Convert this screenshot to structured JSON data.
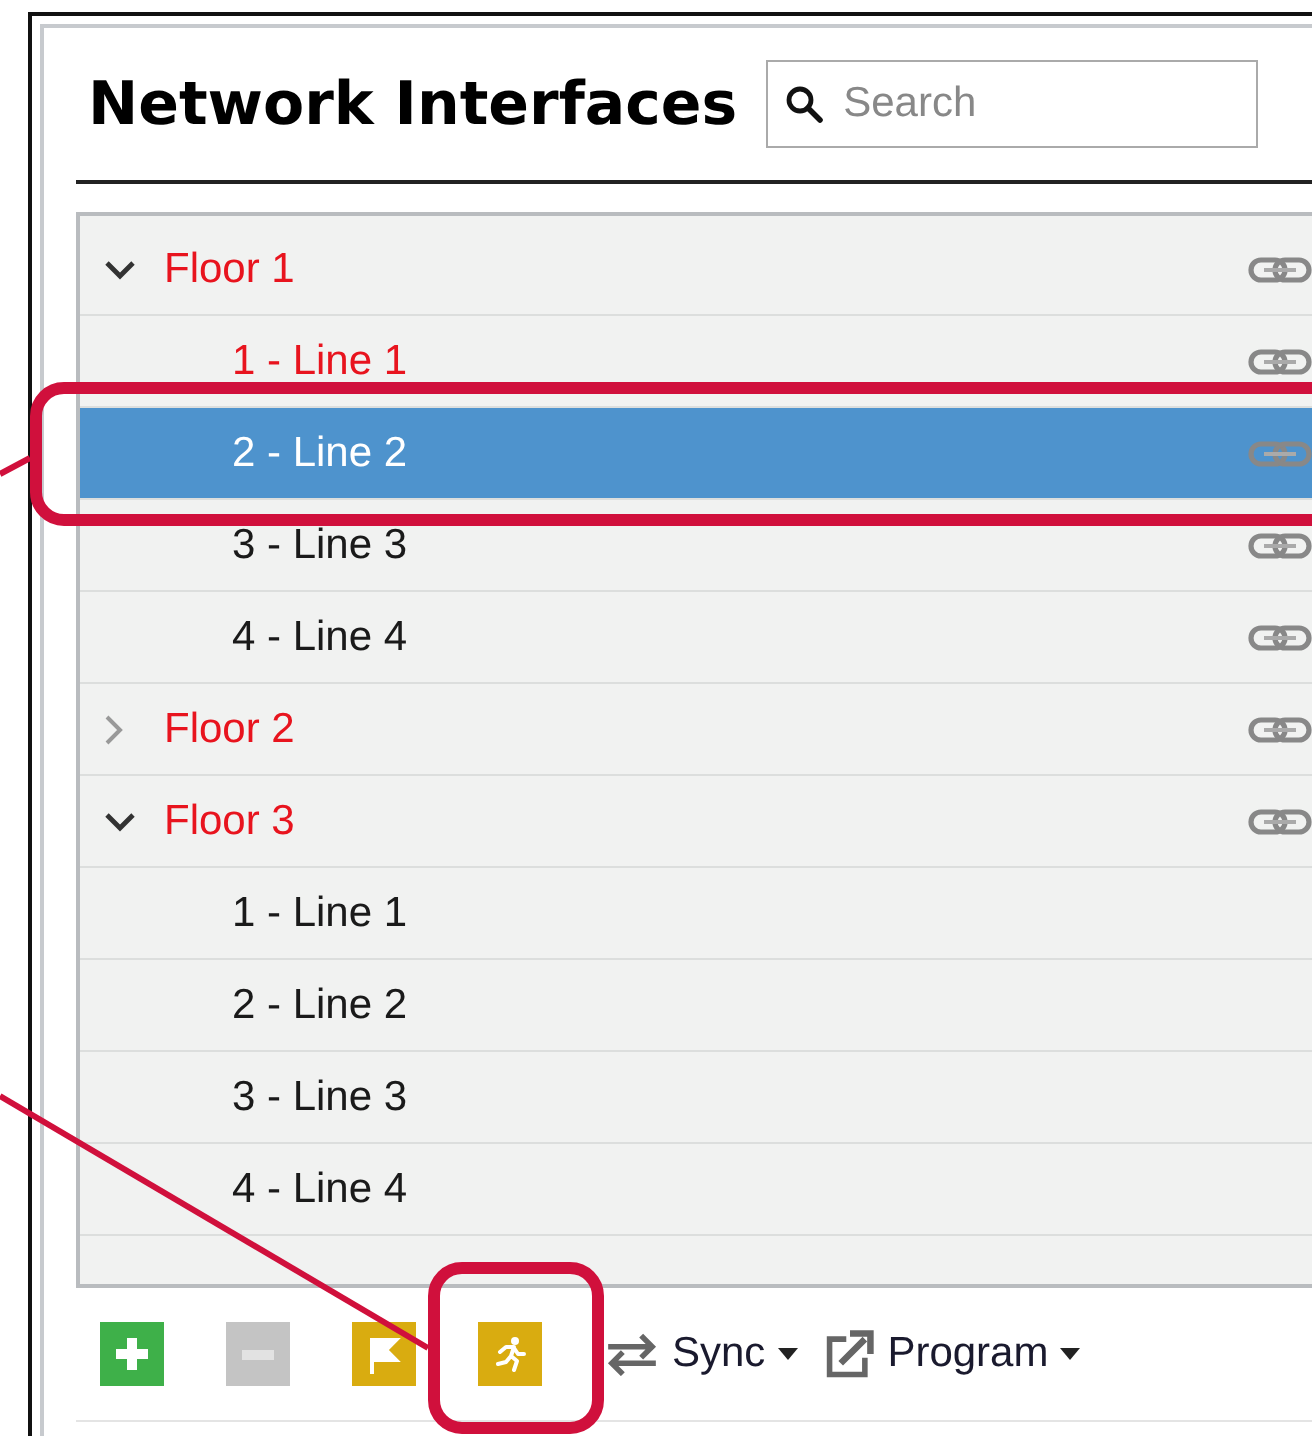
{
  "panel": {
    "title": "Network Interfaces"
  },
  "search": {
    "placeholder": "Search"
  },
  "tree": [
    {
      "label": "Floor 1",
      "expanded": true,
      "linked": true,
      "selected": false,
      "color": "#e8141e",
      "children": [
        {
          "label": "1 - Line 1",
          "linked": true,
          "selected": false,
          "color": "#e8141e"
        },
        {
          "label": "2 - Line 2",
          "linked": true,
          "selected": true
        },
        {
          "label": "3 - Line 3",
          "linked": true,
          "selected": false,
          "color": "#1a1a1a"
        },
        {
          "label": "4 - Line 4",
          "linked": true,
          "selected": false,
          "color": "#1a1a1a"
        }
      ]
    },
    {
      "label": "Floor 2",
      "expanded": false,
      "linked": true,
      "selected": false,
      "color": "#e8141e"
    },
    {
      "label": "Floor 3",
      "expanded": true,
      "linked": true,
      "selected": false,
      "color": "#e8141e",
      "children": [
        {
          "label": "1 - Line 1",
          "linked": false,
          "selected": false,
          "color": "#1a1a1a"
        },
        {
          "label": "2 - Line 2",
          "linked": false,
          "selected": false,
          "color": "#1a1a1a"
        },
        {
          "label": "3 - Line 3",
          "linked": false,
          "selected": false,
          "color": "#1a1a1a"
        },
        {
          "label": "4 - Line 4",
          "linked": false,
          "selected": false,
          "color": "#1a1a1a"
        }
      ]
    }
  ],
  "toolbar": [
    {
      "kind": "add",
      "disabled": false
    },
    {
      "kind": "remove",
      "disabled": true
    },
    {
      "kind": "flag",
      "disabled": false
    },
    {
      "kind": "run",
      "disabled": false
    },
    {
      "kind": "sync",
      "label": "Sync",
      "disabled": false
    },
    {
      "kind": "program",
      "label": "Program",
      "disabled": false
    }
  ]
}
